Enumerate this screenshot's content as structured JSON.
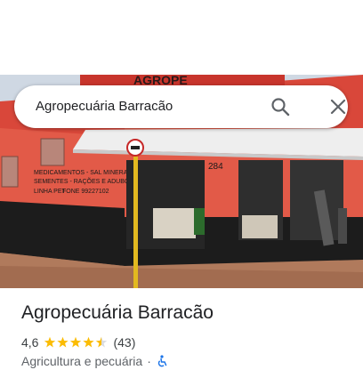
{
  "search": {
    "query": "Agropecuária Barracão"
  },
  "photo": {
    "sign_text": "AGROPE",
    "wall_lines": [
      "MEDICAMENTOS - SAL MINERAL",
      "SEMENTES - RAÇÕES E ADUBOS",
      "LINHA PET",
      "FONE 99227102"
    ],
    "house_number": "284"
  },
  "place": {
    "name": "Agropecuária Barracão",
    "rating": "4,6",
    "stars": 4.5,
    "review_count": "(43)",
    "category": "Agricultura e pecuária",
    "separator": "·"
  },
  "colors": {
    "star": "#fbbc04",
    "accessible_icon": "#1a73e8",
    "wall": "#e8594a",
    "awning": "#eeeeee"
  },
  "icons": {
    "search": "search-icon",
    "close": "close-icon",
    "wheelchair": "wheelchair-icon"
  }
}
